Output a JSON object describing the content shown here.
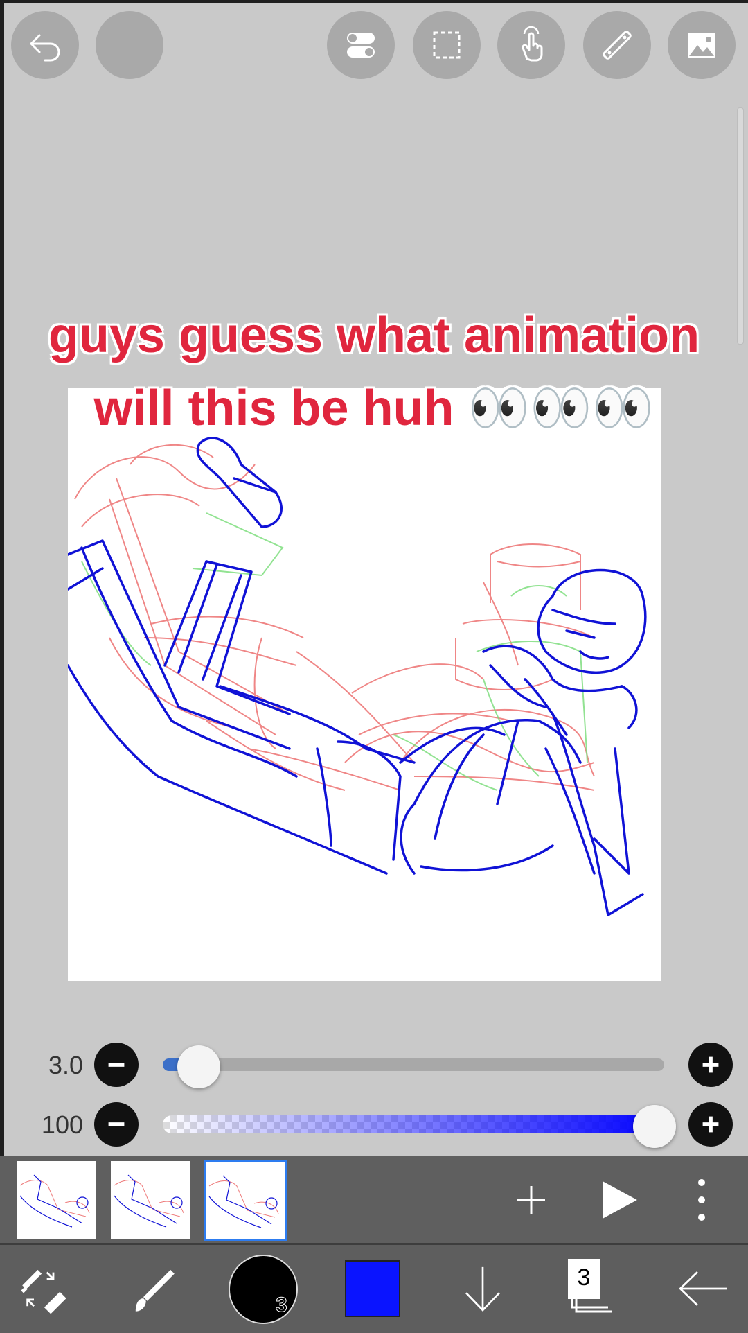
{
  "toolbar": {
    "buttons": [
      {
        "name": "undo-icon"
      },
      {
        "name": "redo-icon"
      },
      {
        "name": "toggle-icon"
      },
      {
        "name": "selection-icon"
      },
      {
        "name": "gesture-icon"
      },
      {
        "name": "ruler-icon"
      },
      {
        "name": "image-icon"
      }
    ]
  },
  "caption": {
    "line1": "guys guess what animation",
    "line2": "will this be huh 👀👀👀"
  },
  "brush": {
    "size_label": "3.0",
    "size_value": 3.0,
    "opacity_label": "100",
    "opacity_value": 100
  },
  "timeline": {
    "frames": 3,
    "active_frame": 3
  },
  "bottom_bar": {
    "color_hex": "#000000",
    "secondary_color_hex": "#0a14ff",
    "color_sub_label": "3",
    "layers_label": "3"
  },
  "colors": {
    "caption": "#e0263e",
    "slider_accent": "#3b6fc8",
    "opacity_gradient_end": "#0000ff",
    "active_frame_border": "#2d7cf0"
  }
}
